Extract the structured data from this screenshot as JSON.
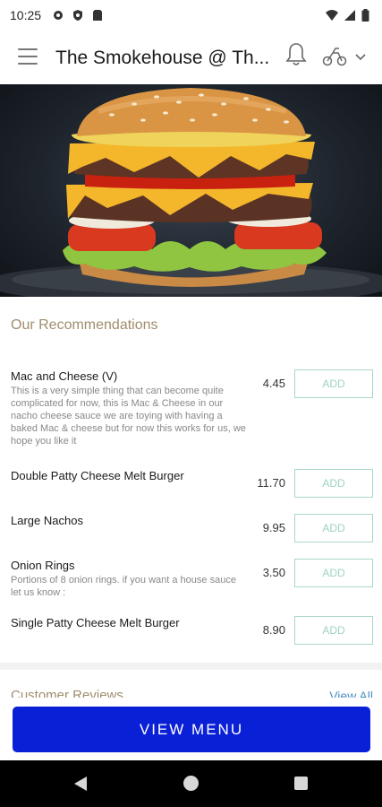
{
  "status_bar": {
    "time": "10:25",
    "icons_left": [
      "gear-icon",
      "shield-icon",
      "sim-icon"
    ],
    "icons_right": [
      "wifi-icon",
      "signal-icon",
      "battery-icon"
    ]
  },
  "app_bar": {
    "title": "The Smokehouse @ Th...",
    "icons": [
      "menu-icon",
      "bell-icon",
      "scooter-icon",
      "chevron-down-icon"
    ]
  },
  "hero": {
    "image": "burger-photo"
  },
  "recommendations": {
    "title": "Our Recommendations",
    "items": [
      {
        "name": "Mac and Cheese (V)",
        "description": "This is a very simple thing that can become quite complicated for now, this is Mac & Cheese in our nacho cheese sauce we are toying with having a baked Mac & cheese but for now this works for us, we hope you like it",
        "price": "4.45",
        "add_label": "ADD"
      },
      {
        "name": "Double Patty Cheese Melt Burger",
        "description": "",
        "price": "11.70",
        "add_label": "ADD"
      },
      {
        "name": "Large Nachos",
        "description": "",
        "price": "9.95",
        "add_label": "ADD"
      },
      {
        "name": "Onion Rings",
        "description": "Portions of 8 onion rings. if you want a house sauce let us know :",
        "price": "3.50",
        "add_label": "ADD"
      },
      {
        "name": "Single Patty Cheese Melt Burger",
        "description": "",
        "price": "8.90",
        "add_label": "ADD"
      }
    ]
  },
  "reviews": {
    "title": "Customer Reviews",
    "view_all": "View All"
  },
  "view_menu_label": "VIEW MENU",
  "colors": {
    "accent": "#0a20d6",
    "section_title": "#a08d6c",
    "add_border": "#a9d9c4",
    "link": "#4a8fc2"
  }
}
